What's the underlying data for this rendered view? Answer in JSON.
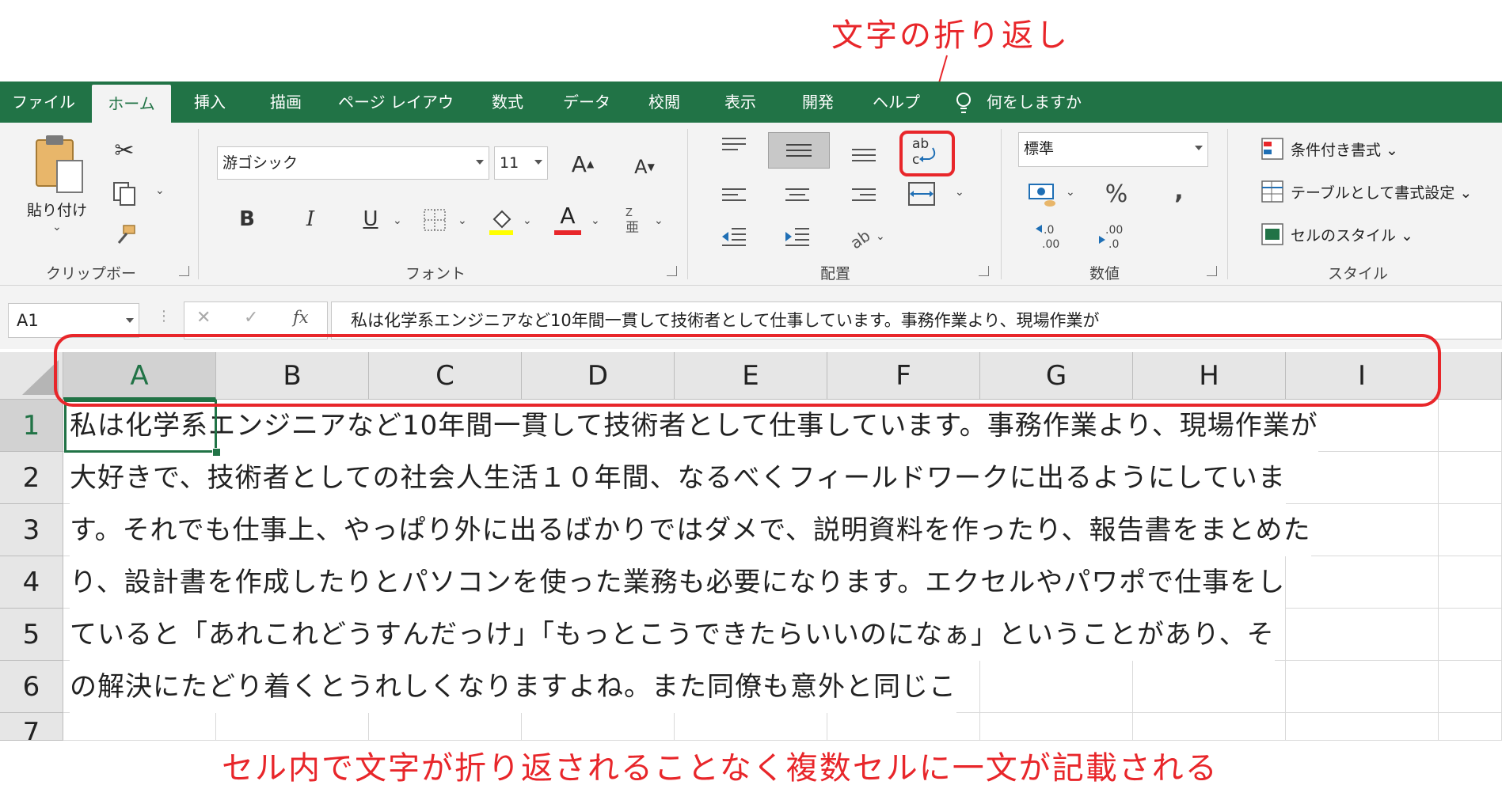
{
  "annotations": {
    "top": "文字の折り返し",
    "bottom": "セル内で文字が折り返されることなく複数セルに一文が記載される"
  },
  "menu": {
    "tabs": [
      "ファイル",
      "ホーム",
      "挿入",
      "描画",
      "ページ レイアウト",
      "数式",
      "データ",
      "校閲",
      "表示",
      "開発",
      "ヘルプ"
    ],
    "active_tab": "ホーム",
    "tell_me": "何をしますか"
  },
  "ribbon": {
    "clipboard": {
      "paste_label": "貼り付け",
      "group_label": "クリップボード"
    },
    "font": {
      "font_name": "游ゴシック",
      "font_size": "11",
      "bold": "B",
      "italic": "I",
      "underline": "U",
      "font_color_letter": "A",
      "grow": "A",
      "shrink": "A",
      "group_label": "フォント"
    },
    "alignment": {
      "wrap_text_glyph": "ab c",
      "group_label": "配置"
    },
    "number": {
      "format": "標準",
      "percent": "%",
      "comma": ",",
      "increase_decimal": "←.0\n.00",
      "decrease_decimal": ".00\n→.0",
      "group_label": "数値"
    },
    "styles": {
      "conditional": "条件付き書式",
      "as_table": "テーブルとして書式設定",
      "cell_styles": "セルのスタイル",
      "group_label": "スタイル"
    }
  },
  "formula_bar": {
    "name_box": "A1",
    "cancel": "✕",
    "enter": "✓",
    "fx": "fx",
    "content": "私は化学系エンジニアなど10年間一貫して技術者として仕事しています。事務作業より、現場作業が"
  },
  "sheet": {
    "columns": [
      "A",
      "B",
      "C",
      "D",
      "E",
      "F",
      "G",
      "H",
      "I"
    ],
    "rows": [
      "1",
      "2",
      "3",
      "4",
      "5",
      "6",
      "7"
    ],
    "cells": [
      "私は化学系エンジニアなど10年間一貫して技術者として仕事しています。事務作業より、現場作業が",
      "大好きで、技術者としての社会人生活１０年間、なるべくフィールドワークに出るようにしていま",
      "す。それでも仕事上、やっぱり外に出るばかりではダメで、説明資料を作ったり、報告書をまとめた",
      "り、設計書を作成したりとパソコンを使った業務も必要になります。エクセルやパワポで仕事をし",
      "ていると「あれこれどうすんだっけ」「もっとこうできたらいいのになぁ」ということがあり、そ",
      "の解決にたどり着くとうれしくなりますよね。また同僚も意外と同じこ"
    ]
  },
  "colors": {
    "excel_green": "#217346",
    "annotation_red": "#e8262a"
  }
}
